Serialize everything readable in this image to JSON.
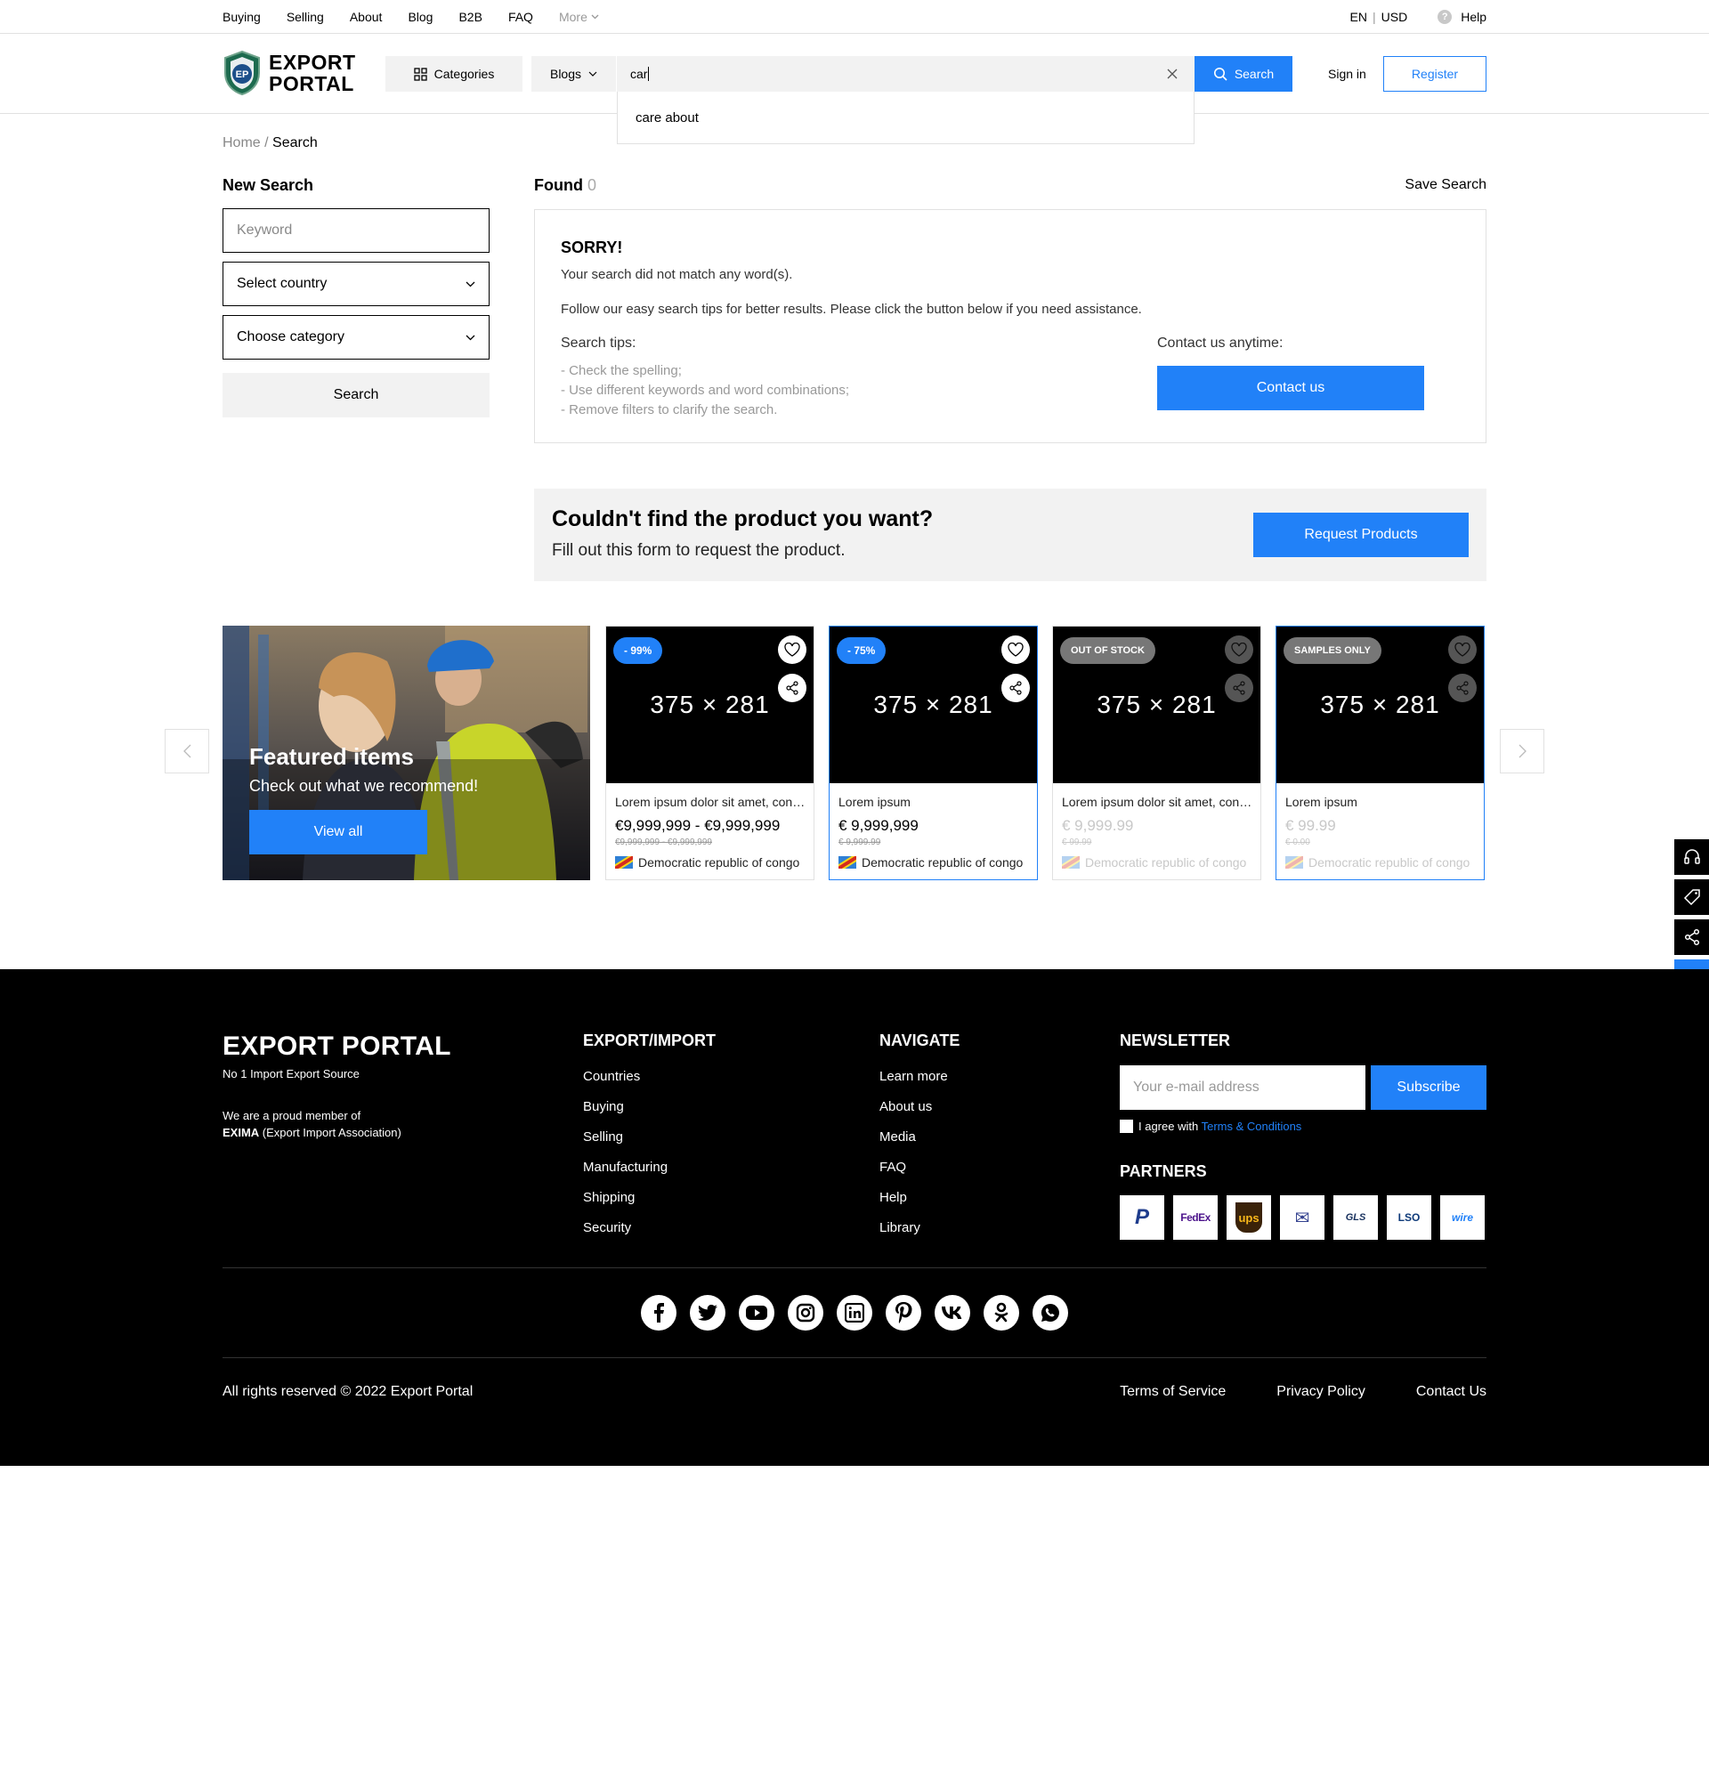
{
  "topnav": {
    "items": [
      "Buying",
      "Selling",
      "About",
      "Blog",
      "B2B",
      "FAQ"
    ],
    "more": "More",
    "lang": "EN",
    "currency": "USD",
    "help": "Help"
  },
  "header": {
    "logo_line1": "EXPORT",
    "logo_line2": "PORTAL",
    "logo_badge": "EP",
    "categories_label": "Categories",
    "blogs_label": "Blogs",
    "search_value": "car",
    "search_button": "Search",
    "signin": "Sign in",
    "register": "Register"
  },
  "autocomplete": {
    "typed": "car",
    "rest": "e about"
  },
  "breadcrumb": {
    "home": "Home",
    "separator": " / ",
    "current": "Search"
  },
  "sidebar": {
    "title": "New Search",
    "keyword_placeholder": "Keyword",
    "country_placeholder": "Select country",
    "category_placeholder": "Choose category",
    "search_button": "Search"
  },
  "results": {
    "found_label": "Found",
    "found_count": "0",
    "save_search": "Save Search",
    "sorry_title": "SORRY!",
    "sorry_text1": "Your search did not match any word(s).",
    "sorry_text2": "Follow our easy search tips for better results. Please click the button below if you need assistance.",
    "tips_title": "Search tips:",
    "tips": [
      "- Check the spelling;",
      "- Use different keywords and word combinations;",
      "- Remove filters to clarify the search."
    ],
    "contact_title": "Contact us anytime:",
    "contact_button": "Contact us"
  },
  "request": {
    "title": "Couldn't find the product you want?",
    "subtitle": "Fill out this form to request the product.",
    "button": "Request Products"
  },
  "featured": {
    "title": "Featured items",
    "subtitle": "Check out what we recommend!",
    "button": "View all"
  },
  "cards": [
    {
      "badge": "- 99%",
      "image_text": "375 × 281",
      "title": "Lorem ipsum dolor sit amet, consectetur",
      "price": "€9,999,999 - €9,999,999",
      "old_price": "€9,999,999 - €9,999,999",
      "country": "Democratic republic of congo"
    },
    {
      "badge": "- 75%",
      "image_text": "375 × 281",
      "title": "Lorem ipsum",
      "price": "€ 9,999,999",
      "old_price": "€ 9,999.99",
      "country": "Democratic republic of congo"
    },
    {
      "badge": "OUT OF STOCK",
      "image_text": "375 × 281",
      "title": "Lorem ipsum dolor sit amet, consectetur",
      "price": "€ 9,999.99",
      "old_price": "€ 99.99",
      "country": "Democratic republic of congo"
    },
    {
      "badge": "SAMPLES ONLY",
      "image_text": "375 × 281",
      "title": "Lorem ipsum",
      "price": "€ 99.99",
      "old_price": "€ 0.00",
      "country": "Democratic republic of congo"
    }
  ],
  "footer": {
    "brand": "EXPORT PORTAL",
    "tagline": "No 1 Import Export Source",
    "member_line1": "We are a proud member of",
    "member_strong": "EXIMA",
    "member_rest": " (Export Import Association)",
    "export_title": "EXPORT/IMPORT",
    "export_items": [
      "Countries",
      "Buying",
      "Selling",
      "Manufacturing",
      "Shipping",
      "Security"
    ],
    "navigate_title": "NAVIGATE",
    "navigate_items": [
      "Learn more",
      "About us",
      "Media",
      "FAQ",
      "Help",
      "Library"
    ],
    "newsletter_title": "NEWSLETTER",
    "email_placeholder": "Your e-mail address",
    "subscribe": "Subscribe",
    "agree_text": "I agree with ",
    "agree_link": "Terms & Conditions",
    "partners_title": "PARTNERS",
    "partners": [
      "PayPal",
      "FedEx",
      "UPS",
      "USPS",
      "GLS",
      "LSO",
      "wire transfer"
    ],
    "partner_labels": [
      "P",
      "FedEx",
      "ups",
      "✉",
      "GLS",
      "LSO",
      "wire"
    ],
    "socials": [
      "facebook-icon",
      "twitter-icon",
      "youtube-icon",
      "instagram-icon",
      "linkedin-icon",
      "pinterest-icon",
      "vk-icon",
      "odnoklassniki-icon",
      "whatsapp-icon"
    ],
    "copyright": "All rights reserved © 2022 Export Portal",
    "links": [
      "Terms of Service",
      "Privacy Policy",
      "Contact Us"
    ]
  },
  "colors": {
    "accent": "#2181f8",
    "footer_bg": "#000000",
    "panel_bg": "#f2f2f2"
  }
}
